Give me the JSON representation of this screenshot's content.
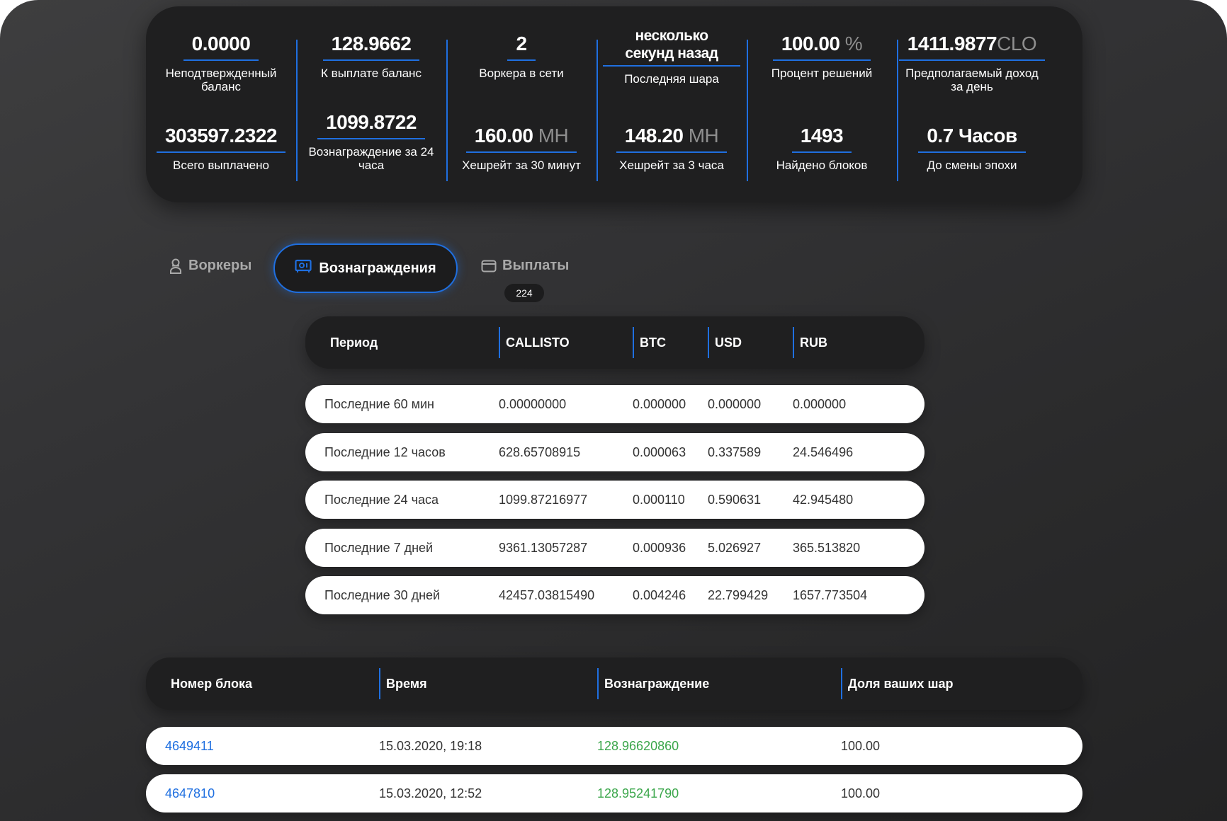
{
  "stats": [
    {
      "top": {
        "value": "0.0000",
        "unit": "",
        "label": "Неподтвержденный баланс"
      },
      "bottom": {
        "value": "303597.2322",
        "unit": "",
        "label": "Всего выплачено"
      }
    },
    {
      "top": {
        "value": "128.9662",
        "unit": "",
        "label": "К выплате баланс"
      },
      "bottom": {
        "value": "1099.8722",
        "unit": "",
        "label": "Вознаграждение за 24 часа"
      }
    },
    {
      "top": {
        "value": "2",
        "unit": "",
        "label": "Воркера в сети"
      },
      "bottom": {
        "value": "160.00",
        "unit": "MH",
        "label": "Хешрейт за 30 минут"
      }
    },
    {
      "top": {
        "value": "несколько секунд назад",
        "unit": "",
        "label": "Последняя шара"
      },
      "bottom": {
        "value": "148.20",
        "unit": "MH",
        "label": "Хешрейт за 3 часа"
      }
    },
    {
      "top": {
        "value": "100.00",
        "unit": "%",
        "label": "Процент решений"
      },
      "bottom": {
        "value": "1493",
        "unit": "",
        "label": "Найдено блоков"
      }
    },
    {
      "top": {
        "value": "1411.9877",
        "unit": "CLO",
        "label": "Предполагаемый доход за день"
      },
      "bottom": {
        "value": "0.7 Часов",
        "unit": "",
        "label": "До смены эпохи"
      }
    }
  ],
  "tabs": {
    "workers": "Воркеры",
    "rewards": "Вознаграждения",
    "payouts": "Выплаты",
    "payouts_count": "224"
  },
  "rewards_table": {
    "headers": [
      "Период",
      "CALLISTO",
      "BTC",
      "USD",
      "RUB"
    ],
    "rows": [
      [
        "Последние 60 мин",
        "0.00000000",
        "0.000000",
        "0.000000",
        "0.000000"
      ],
      [
        "Последние 12 часов",
        "628.65708915",
        "0.000063",
        "0.337589",
        "24.546496"
      ],
      [
        "Последние 24 часа",
        "1099.87216977",
        "0.000110",
        "0.590631",
        "42.945480"
      ],
      [
        "Последние 7 дней",
        "9361.13057287",
        "0.000936",
        "5.026927",
        "365.513820"
      ],
      [
        "Последние 30 дней",
        "42457.03815490",
        "0.004246",
        "22.799429",
        "1657.773504"
      ]
    ]
  },
  "blocks_table": {
    "headers": [
      "Номер блока",
      "Время",
      "Вознаграждение",
      "Доля ваших шар"
    ],
    "rows": [
      [
        "4649411",
        "15.03.2020, 19:18",
        "128.96620860",
        "100.00"
      ],
      [
        "4647810",
        "15.03.2020, 12:52",
        "128.95241790",
        "100.00"
      ]
    ]
  },
  "colors": {
    "accent": "#1f6fe0",
    "reward_green": "#3aa64a",
    "panel": "#1f1f20"
  }
}
